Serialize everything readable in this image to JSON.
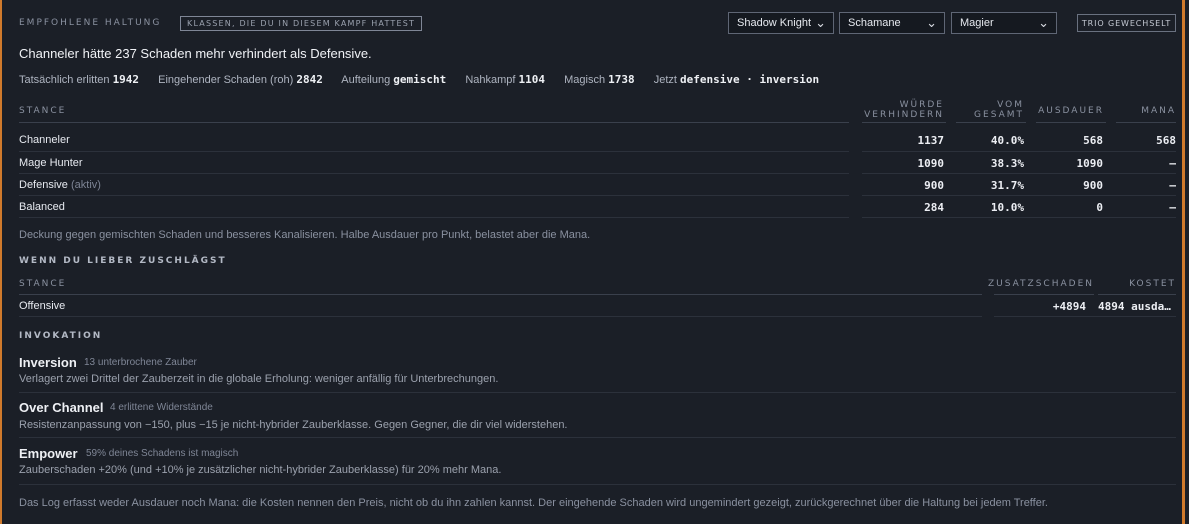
{
  "header": {
    "label": "EMPFOHLENE HALTUNG",
    "chip": "KLASSEN, DIE DU IN DIESEM KAMPF HATTEST",
    "selects": [
      {
        "value": "Shadow Knight"
      },
      {
        "value": "Schamane"
      },
      {
        "value": "Magier"
      }
    ],
    "trio_button": "TRIO GEWECHSELT"
  },
  "headline": "Channeler hätte 237 Schaden mehr verhindert als Defensive.",
  "stats": {
    "taken_label": "Tatsächlich erlitten",
    "taken_value": "1942",
    "raw_label": "Eingehender Schaden (roh)",
    "raw_value": "2842",
    "split_label": "Aufteilung",
    "split_value": "gemischt",
    "melee_label": "Nahkampf",
    "melee_value": "1104",
    "magic_label": "Magisch",
    "magic_value": "1738",
    "now_label": "Jetzt",
    "now_value": "defensive · inversion"
  },
  "stance_table": {
    "headers": {
      "stance": "STANCE",
      "prevent_1": "WÜRDE",
      "prevent_2": "VERHINDERN",
      "total_1": "VOM",
      "total_2": "GESAMT",
      "endurance": "AUSDAUER",
      "mana": "MANA"
    },
    "rows": [
      {
        "name": "Channeler",
        "extra": "",
        "prevent": "1137",
        "total": "40.0%",
        "endurance": "568",
        "mana": "568"
      },
      {
        "name": "Mage Hunter",
        "extra": "",
        "prevent": "1090",
        "total": "38.3%",
        "endurance": "1090",
        "mana": "–"
      },
      {
        "name": "Defensive",
        "extra": "(aktiv)",
        "prevent": "900",
        "total": "31.7%",
        "endurance": "900",
        "mana": "–"
      },
      {
        "name": "Balanced",
        "extra": "",
        "prevent": "284",
        "total": "10.0%",
        "endurance": "0",
        "mana": "–"
      }
    ]
  },
  "stance_note": "Deckung gegen gemischten Schaden und besseres Kanalisieren. Halbe Ausdauer pro Punkt, belastet aber die Mana.",
  "offense": {
    "title": "WENN DU LIEBER ZUSCHLÄGST",
    "headers": {
      "stance": "STANCE",
      "extra": "ZUSATZSCHADEN",
      "cost": "KOSTET"
    },
    "rows": [
      {
        "name": "Offensive",
        "extra": "+4894",
        "cost": "4894 ausda…"
      }
    ]
  },
  "invocation": {
    "title": "INVOKATION",
    "items": [
      {
        "name": "Inversion",
        "meta": "13 unterbrochene Zauber",
        "desc": "Verlagert zwei Drittel der Zauberzeit in die globale Erholung: weniger anfällig für Unterbrechungen."
      },
      {
        "name": "Over Channel",
        "meta": "4 erlittene Widerstände",
        "desc": "Resistenzanpassung von −150, plus −15 je nicht-hybrider Zauberklasse. Gegen Gegner, die dir viel widerstehen."
      },
      {
        "name": "Empower",
        "meta": "59% deines Schadens ist magisch",
        "desc": "Zauberschaden +20% (und +10% je zusätzlicher nicht-hybrider Zauberklasse) für 20% mehr Mana."
      }
    ]
  },
  "footer_note": "Das Log erfasst weder Ausdauer noch Mana: die Kosten nennen den Preis, nicht ob du ihn zahlen kannst. Der eingehende Schaden wird ungemindert gezeigt, zurückgerechnet über die Haltung bei jedem Treffer."
}
